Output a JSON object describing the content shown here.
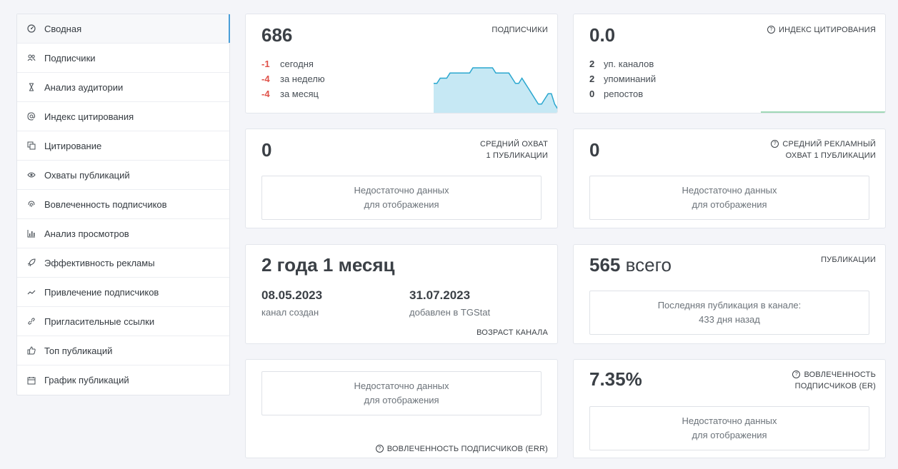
{
  "sidebar": {
    "items": [
      {
        "label": "Сводная",
        "icon": "dashboard-icon"
      },
      {
        "label": "Подписчики",
        "icon": "users-icon"
      },
      {
        "label": "Анализ аудитории",
        "icon": "hourglass-icon"
      },
      {
        "label": "Индекс цитирования",
        "icon": "at-icon"
      },
      {
        "label": "Цитирование",
        "icon": "copy-icon"
      },
      {
        "label": "Охваты публикаций",
        "icon": "eye-icon"
      },
      {
        "label": "Вовлеченность подписчиков",
        "icon": "fingerprint-icon"
      },
      {
        "label": "Анализ просмотров",
        "icon": "bar-chart-icon"
      },
      {
        "label": "Эффективность рекламы",
        "icon": "rocket-icon"
      },
      {
        "label": "Привлечение подписчиков",
        "icon": "trend-icon"
      },
      {
        "label": "Пригласительные ссылки",
        "icon": "link-icon"
      },
      {
        "label": "Топ публикаций",
        "icon": "thumbs-up-icon"
      },
      {
        "label": "График публикаций",
        "icon": "calendar-icon"
      }
    ]
  },
  "subscribers": {
    "value": "686",
    "label": "ПОДПИСЧИКИ",
    "rows": [
      {
        "value": "-1",
        "caption": "сегодня"
      },
      {
        "value": "-4",
        "caption": "за неделю"
      },
      {
        "value": "-4",
        "caption": "за месяц"
      }
    ],
    "sparkline": [
      690,
      690,
      691,
      691,
      691,
      692,
      692,
      692,
      692,
      692,
      692,
      692,
      693,
      693,
      693,
      693,
      693,
      693,
      693,
      692,
      692,
      692,
      692,
      692,
      691,
      690,
      690,
      691,
      690,
      689,
      688,
      687,
      686,
      686,
      687,
      688,
      688,
      686,
      685
    ]
  },
  "citation": {
    "value": "0.0",
    "label": "ИНДЕКС ЦИТИРОВАНИЯ",
    "rows": [
      {
        "value": "2",
        "caption": "уп. каналов"
      },
      {
        "value": "2",
        "caption": "упоминаний"
      },
      {
        "value": "0",
        "caption": "репостов"
      }
    ]
  },
  "avg_reach": {
    "value": "0",
    "label_line1": "СРЕДНИЙ ОХВАТ",
    "label_line2": "1 ПУБЛИКАЦИИ",
    "nodata_line1": "Недостаточно данных",
    "nodata_line2": "для отображения"
  },
  "avg_ad_reach": {
    "value": "0",
    "label_line1": "СРЕДНИЙ РЕКЛАМНЫЙ",
    "label_line2": "ОХВАТ 1 ПУБЛИКАЦИИ",
    "nodata_line1": "Недостаточно данных",
    "nodata_line2": "для отображения"
  },
  "channel_age": {
    "value": "2 года 1 месяц",
    "created_date": "08.05.2023",
    "created_caption": "канал создан",
    "added_date": "31.07.2023",
    "added_caption": "добавлен в TGStat",
    "label": "ВОЗРАСТ КАНАЛА"
  },
  "publications": {
    "value": "565",
    "value_suffix": "всего",
    "label": "ПУБЛИКАЦИИ",
    "last_line1": "Последняя публикация в канале:",
    "last_line2": "433 дня назад"
  },
  "err": {
    "nodata_line1": "Недостаточно данных",
    "nodata_line2": "для отображения",
    "label": "ВОВЛЕЧЕННОСТЬ ПОДПИСЧИКОВ (ERR)"
  },
  "er": {
    "value": "7.35%",
    "label_line1": "ВОВЛЕЧЕННОСТЬ",
    "label_line2": "ПОДПИСЧИКОВ (ER)",
    "nodata_line1": "Недостаточно данных",
    "nodata_line2": "для отображения"
  },
  "colors": {
    "accent": "#4a9fd8",
    "negative": "#e0524a",
    "sparkline_stroke": "#2aa7cf",
    "sparkline_fill": "#c6e8f4",
    "green_line": "#9fd8b6"
  }
}
